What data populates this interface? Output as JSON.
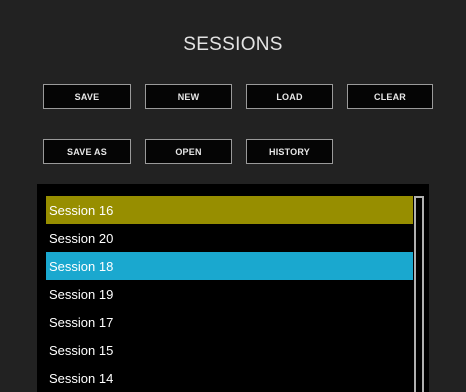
{
  "title": "SESSIONS",
  "buttons": {
    "save": "SAVE",
    "new": "NEW",
    "load": "LOAD",
    "clear": "CLEAR",
    "save_as": "SAVE AS",
    "open": "OPEN",
    "history": "HISTORY"
  },
  "sessions": [
    {
      "label": "Session 16",
      "state": "highlight-olive"
    },
    {
      "label": "Session 20",
      "state": "normal"
    },
    {
      "label": "Session 18",
      "state": "highlight-blue"
    },
    {
      "label": "Session 19",
      "state": "normal"
    },
    {
      "label": "Session 17",
      "state": "normal"
    },
    {
      "label": "Session 15",
      "state": "normal"
    },
    {
      "label": "Session 14",
      "state": "normal"
    }
  ],
  "colors": {
    "background": "#222222",
    "list_background": "#000000",
    "highlight_olive": "#978e00",
    "highlight_blue": "#1aa8cf"
  }
}
